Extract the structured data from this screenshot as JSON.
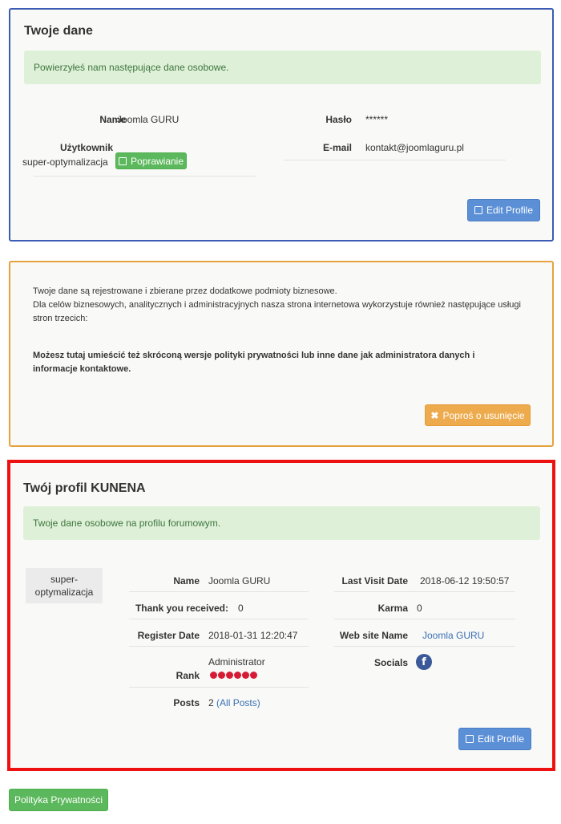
{
  "personal": {
    "title": "Twoje dane",
    "alert": "Powierzyłeś nam następujące dane osobowe.",
    "name_label": "Name",
    "name_value": "Joomla GURU",
    "user_label": "Użytkownik",
    "user_value": "super-optymalizacja",
    "fix_button": "Poprawianie",
    "password_label": "Hasło",
    "password_value": "******",
    "email_label": "E-mail",
    "email_value": "kontakt@joomlaguru.pl",
    "edit_button": "Edit Profile"
  },
  "policy": {
    "line1": "Twoje dane są rejestrowane i zbierane przez dodatkowe podmioty biznesowe.",
    "line2": "Dla celów biznesowych, analitycznych i administracyjnych nasza strona internetowa wykorzystuje również następujące usługi stron trzecich:",
    "bold_text": "Możesz tutaj umieścić też skróconą wersje polityki prywatności lub inne dane jak administratora danych i informacje kontaktowe.",
    "delete_button": "Poproś o usunięcie"
  },
  "kunena": {
    "title": "Twój profil KUNENA",
    "alert": "Twoje dane osobowe na profilu forumowym.",
    "avatar_name": "super-optymalizacja",
    "name_label": "Name",
    "name_value": "Joomla GURU",
    "thanks_label": "Thank you received:",
    "thanks_value": "0",
    "register_label": "Register Date",
    "register_value": "2018-01-31 12:20:47",
    "rank_label": "Rank",
    "rank_value": "Administrator",
    "rank_stars": 6,
    "posts_label": "Posts",
    "posts_value": "2",
    "posts_link": "(All Posts)",
    "last_visit_label": "Last Visit Date",
    "last_visit_value": "2018-06-12 19:50:57",
    "karma_label": "Karma",
    "karma_value": "0",
    "website_label": "Web site Name",
    "website_value": "Joomla GURU",
    "socials_label": "Socials",
    "socials_icon": "facebook-icon",
    "edit_button": "Edit Profile"
  },
  "footer": {
    "privacy_button": "Polityka Prywatności"
  },
  "colors": {
    "blue_border": "#3b5bb5",
    "orange_border": "#e6a23c",
    "red_border": "#ee1111",
    "success_bg": "#dff0d8",
    "success_text": "#3c763d"
  }
}
